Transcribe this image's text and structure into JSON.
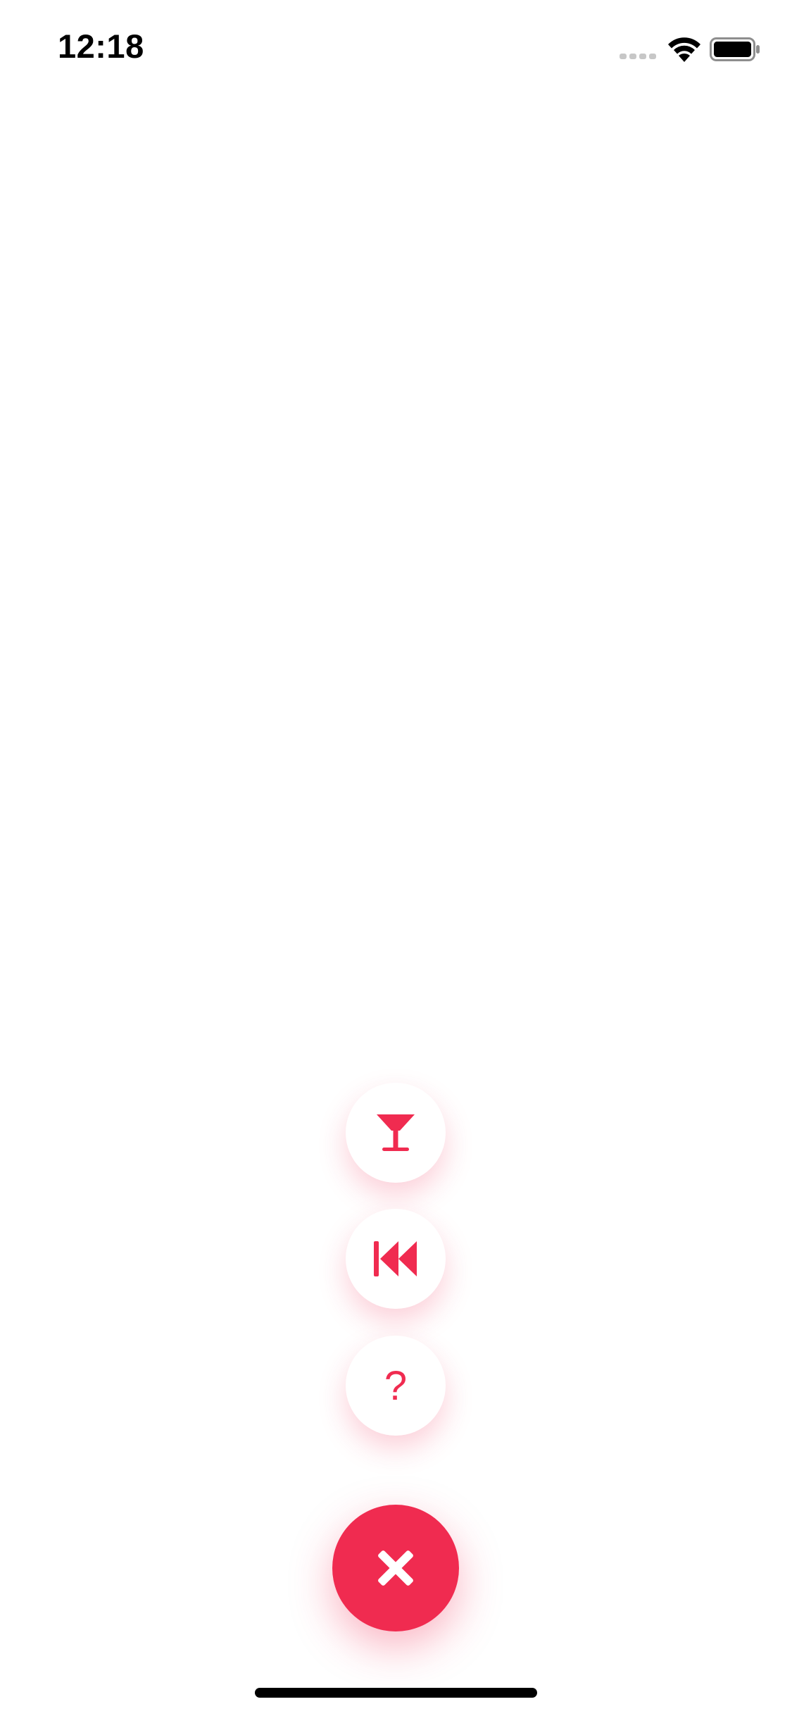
{
  "status_bar": {
    "time": "12:18",
    "signal_icon": "cellular-signal-icon",
    "wifi_icon": "wifi-icon",
    "battery_icon": "battery-full-icon"
  },
  "fab_menu": {
    "accent_color": "#f02b50",
    "items": [
      {
        "icon": "cocktail-glass-icon"
      },
      {
        "icon": "rewind-icon"
      },
      {
        "icon": "question-mark-icon",
        "label": "?"
      }
    ],
    "main_button_icon": "close-icon"
  }
}
